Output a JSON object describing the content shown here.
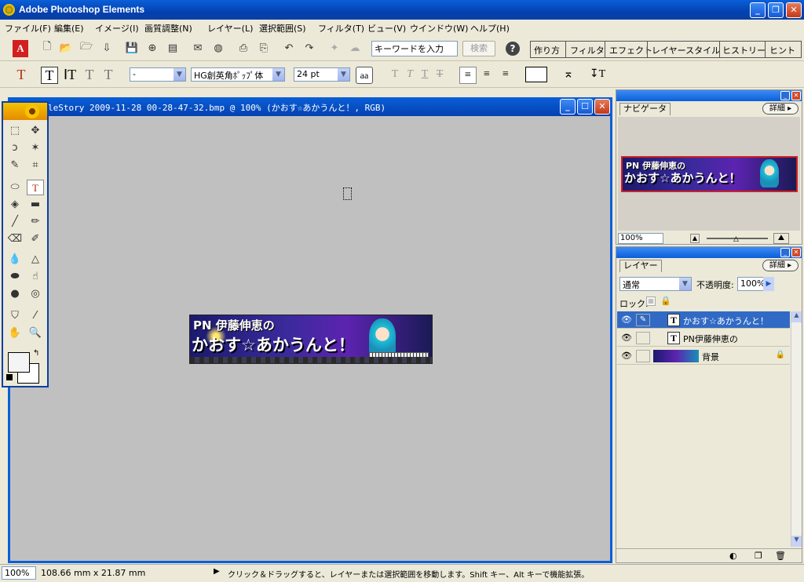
{
  "app": {
    "title": "Adobe Photoshop Elements"
  },
  "menu": [
    "ファイル(F)",
    "編集(E)",
    "イメージ(I)",
    "画質調整(N)",
    "レイヤー(L)",
    "選択範囲(S)",
    "フィルタ(T)",
    "ビュー(V)",
    "ウインドウ(W)",
    "ヘルプ(H)"
  ],
  "shortcuts": {
    "search_placeholder": "キーワードを入力",
    "search_button": "検索",
    "help": "?",
    "palette_tabs": [
      "作り方",
      "フィルタ",
      "エフェクト",
      "レイヤースタイル",
      "ヒストリー",
      "ヒント"
    ]
  },
  "options": {
    "font_style": "-",
    "font_family": "HG創英角ﾎﾟｯﾌﾟ体",
    "font_size": "24 pt",
    "anti_alias": "aa"
  },
  "document": {
    "title": "leStory 2009-11-28 00-28-47-32.bmp @ 100% (かおす☆あかうんと！, RGB)",
    "banner_line1": "PN 伊藤伸恵の",
    "banner_line2": "かおす☆あかうんと！"
  },
  "navigator": {
    "tab": "ナビゲータ",
    "detail": "詳細",
    "zoom": "100%"
  },
  "layers": {
    "tab": "レイヤー",
    "detail": "詳細",
    "blend_mode": "通常",
    "opacity_label": "不透明度:",
    "opacity_value": "100%",
    "lock_label": "ロック:",
    "items": [
      {
        "name": "かおす☆あかうんと！",
        "type": "text",
        "active": true
      },
      {
        "name": "PN伊藤伸恵の",
        "type": "text",
        "active": false
      },
      {
        "name": "背景",
        "type": "image",
        "active": false
      }
    ]
  },
  "status": {
    "zoom": "100%",
    "dimensions": "108.66 mm x 21.87 mm",
    "hint": "クリック＆ドラッグすると、レイヤーまたは選択範囲を移動します。Shift キー、Alt キーで機能拡張。"
  },
  "colors": {
    "titlebar": "#0a5fd8",
    "canvas_bg": "#c0c0c0",
    "selected_layer": "#316ac5",
    "chrome": "#ece9d8"
  }
}
